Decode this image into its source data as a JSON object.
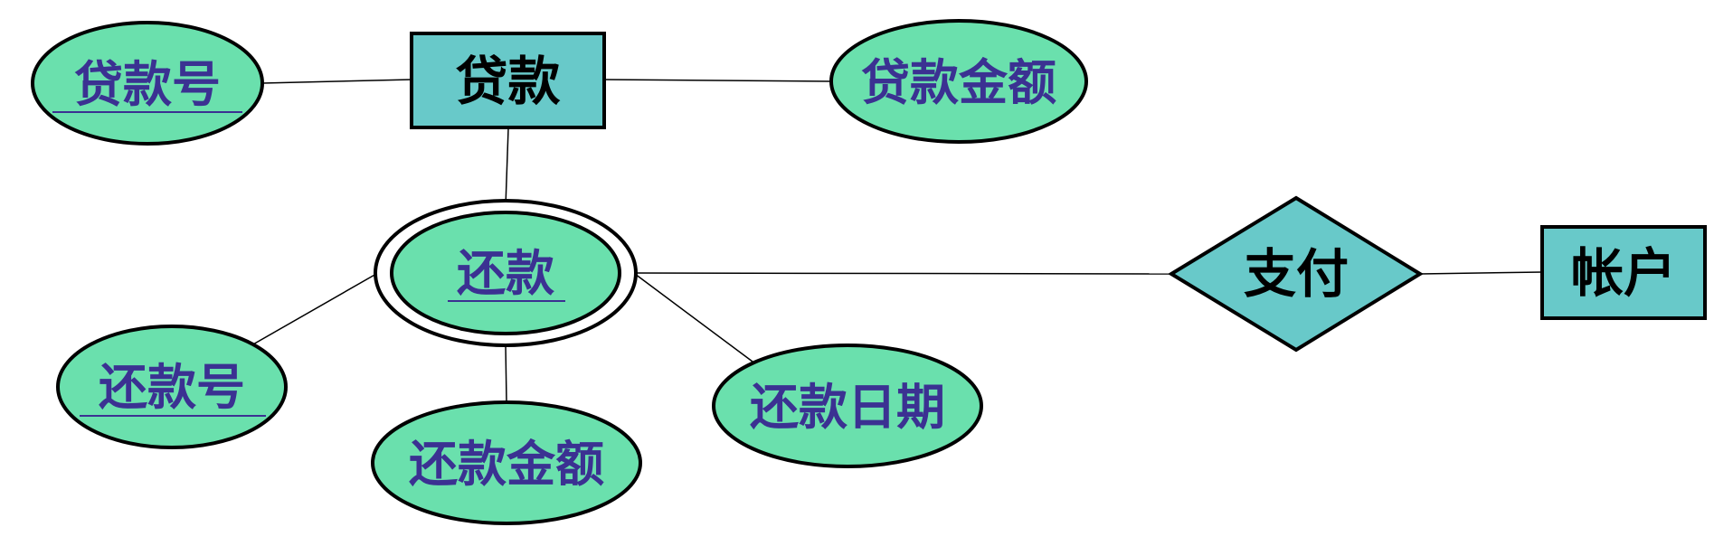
{
  "colors": {
    "entity_fill": "#68c9c9",
    "attribute_fill": "#6ae0ad",
    "relationship_fill": "#68c9c9",
    "outline": "#000000",
    "entity_text": "#000000",
    "attribute_text": "#3b3192"
  },
  "entities": {
    "loan": {
      "label": "贷款"
    },
    "account": {
      "label": "帐户"
    }
  },
  "weak_entity": {
    "label": "还款"
  },
  "relationship": {
    "label": "支付"
  },
  "attributes": {
    "loan_number": {
      "label": "贷款号",
      "key": true
    },
    "loan_amount": {
      "label": "贷款金额",
      "key": false
    },
    "payment_number": {
      "label": "还款号",
      "key": true
    },
    "payment_amount": {
      "label": "还款金额",
      "key": false
    },
    "payment_date": {
      "label": "还款日期",
      "key": false
    }
  }
}
